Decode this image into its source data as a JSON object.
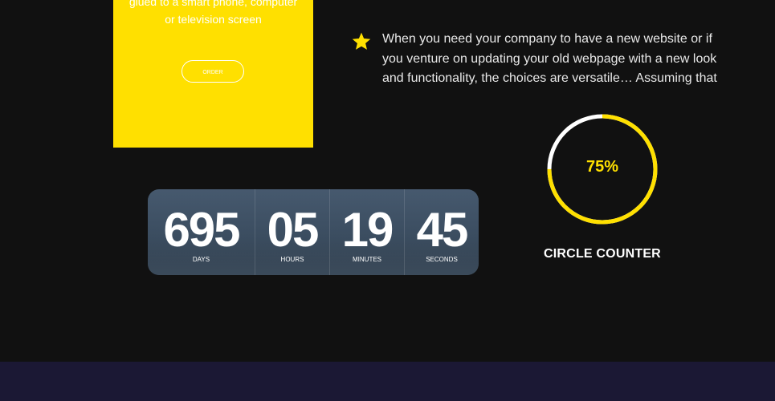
{
  "card": {
    "text_line1": "glued to a smart phone, computer",
    "text_line2": "or television screen",
    "order_label": "ORDER",
    "background": "#ffe000"
  },
  "feature": {
    "icon": "star-icon",
    "text": "When you need your company to have a new website or if you venture on updating your old webpage with a new look and functionality, the choices are versatile… Assuming that"
  },
  "countdown": {
    "units": [
      {
        "value": "695",
        "label": "DAYS"
      },
      {
        "value": "05",
        "label": "HOURS"
      },
      {
        "value": "19",
        "label": "MINUTES"
      },
      {
        "value": "45",
        "label": "SECONDS"
      }
    ]
  },
  "circle_counter": {
    "value_text": "75%",
    "progress": 0.75,
    "title": "CIRCLE COUNTER",
    "accent": "#ffe000",
    "track": "#ffffff"
  },
  "colors": {
    "background": "#111111",
    "footer": "#1b1834"
  }
}
